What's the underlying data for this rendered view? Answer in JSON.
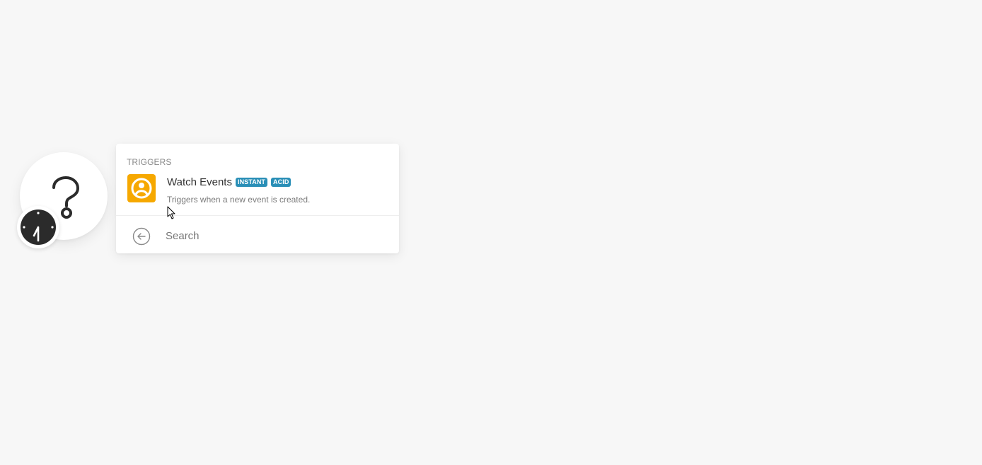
{
  "colors": {
    "background": "#f7f7f7",
    "app_icon": "#f6a800",
    "tag": "#2a8fb7",
    "clock": "#2b2b2b"
  },
  "module": {
    "icon": "question-mark-icon",
    "badge_icon": "clock-icon"
  },
  "dropdown": {
    "section_title": "TRIGGERS",
    "items": [
      {
        "icon": "app-logo-icon",
        "title": "Watch Events",
        "tags": [
          "INSTANT",
          "ACID"
        ],
        "description": "Triggers when a new event is created."
      }
    ],
    "back_icon": "arrow-left-circle-icon",
    "search": {
      "placeholder": "Search",
      "value": ""
    }
  },
  "cursor_icon": "mouse-pointer-icon"
}
